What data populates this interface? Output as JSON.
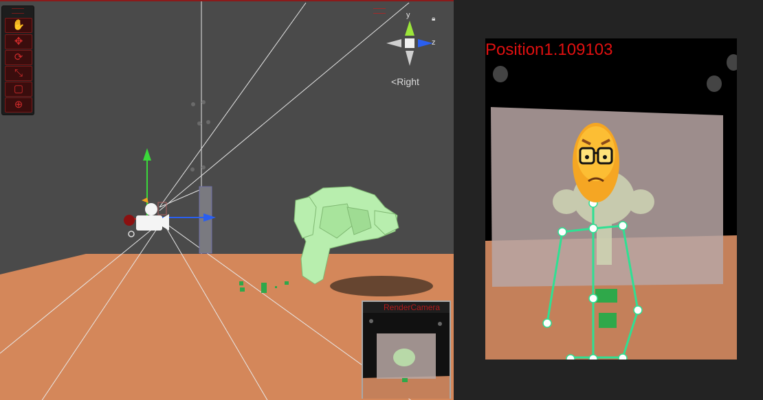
{
  "scene_view": {
    "tools": [
      {
        "name": "hand-tool",
        "glyph": "✋"
      },
      {
        "name": "move-tool",
        "glyph": "✥"
      },
      {
        "name": "rotate-tool",
        "glyph": "⟳"
      },
      {
        "name": "scale-tool",
        "glyph": "⤡"
      },
      {
        "name": "rect-tool",
        "glyph": "▢"
      },
      {
        "name": "transform-tool",
        "glyph": "⊕"
      }
    ],
    "gizmo": {
      "y_label": "y",
      "z_label": "z",
      "view_label": "Right"
    },
    "render_preview_title": "RenderCamera",
    "colors": {
      "accent": "#d02b2b",
      "floor": "#d4875a",
      "monkey": "#b8eeae",
      "cube": "#2fa84a"
    }
  },
  "game_view": {
    "position_text": "Position1.109103",
    "colors": {
      "text": "#e01010",
      "skeleton": "#2fe093",
      "face": "#f5a623"
    }
  }
}
